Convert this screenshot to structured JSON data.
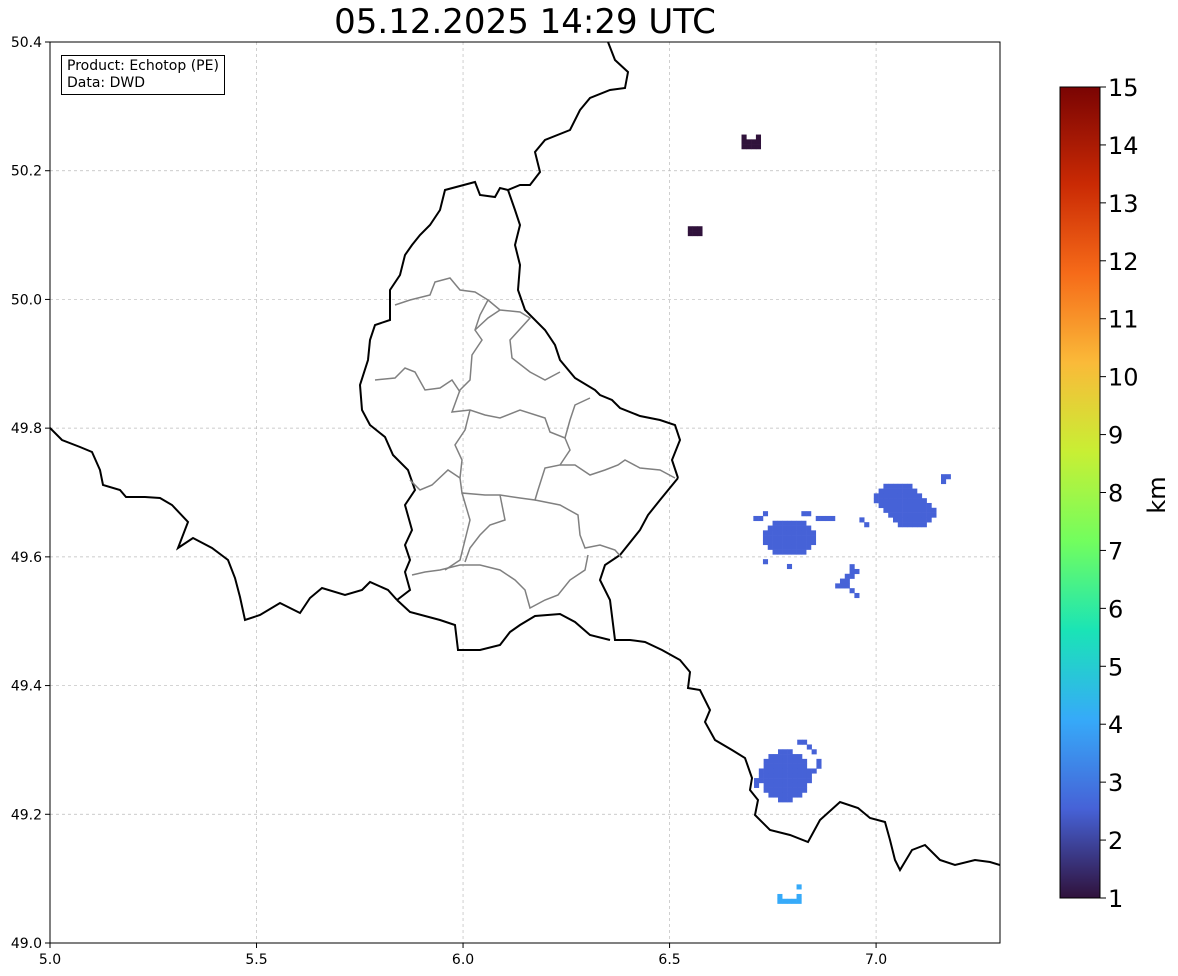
{
  "title": "05.12.2025 14:29 UTC",
  "info": {
    "product": "Product: Echotop (PE)",
    "data": "Data: DWD"
  },
  "map": {
    "lon_range": [
      5.0,
      7.3
    ],
    "lat_range": [
      49.0,
      50.4
    ],
    "grid": true,
    "x_ticks": [
      "5.0",
      "5.5",
      "6.0",
      "6.5",
      "7.0"
    ],
    "y_ticks": [
      "49.0",
      "49.2",
      "49.4",
      "49.6",
      "49.8",
      "50.0",
      "50.2",
      "50.4"
    ]
  },
  "colorbar": {
    "label": "km",
    "min": 1,
    "max": 15,
    "ticks": [
      "1",
      "2",
      "3",
      "4",
      "5",
      "6",
      "7",
      "8",
      "9",
      "10",
      "11",
      "12",
      "13",
      "14",
      "15"
    ],
    "colormap": "turbo",
    "colors": [
      "#30123b",
      "#4662d7",
      "#36aaf9",
      "#1ae4b6",
      "#72fe5e",
      "#c8ef34",
      "#faba39",
      "#f66b19",
      "#ca2a04",
      "#7a0403"
    ]
  },
  "echo_cells": [
    {
      "id": "cell-nw-1",
      "lon": 6.68,
      "lat": 50.245,
      "height_km": 1.1
    },
    {
      "id": "cell-nw-2",
      "lon": 6.55,
      "lat": 50.11,
      "height_km": 1.1
    },
    {
      "id": "cell-mid-west",
      "lon": 6.79,
      "lat": 49.63,
      "height_km": 2.1
    },
    {
      "id": "cell-mid-east",
      "lon": 7.07,
      "lat": 49.68,
      "height_km": 2.1
    },
    {
      "id": "cell-mid-small",
      "lon": 6.93,
      "lat": 49.57,
      "height_km": 2.1
    },
    {
      "id": "cell-south",
      "lon": 6.78,
      "lat": 49.26,
      "height_km": 2.9
    },
    {
      "id": "cell-far-south",
      "lon": 6.79,
      "lat": 49.065,
      "height_km": 3.4
    }
  ]
}
